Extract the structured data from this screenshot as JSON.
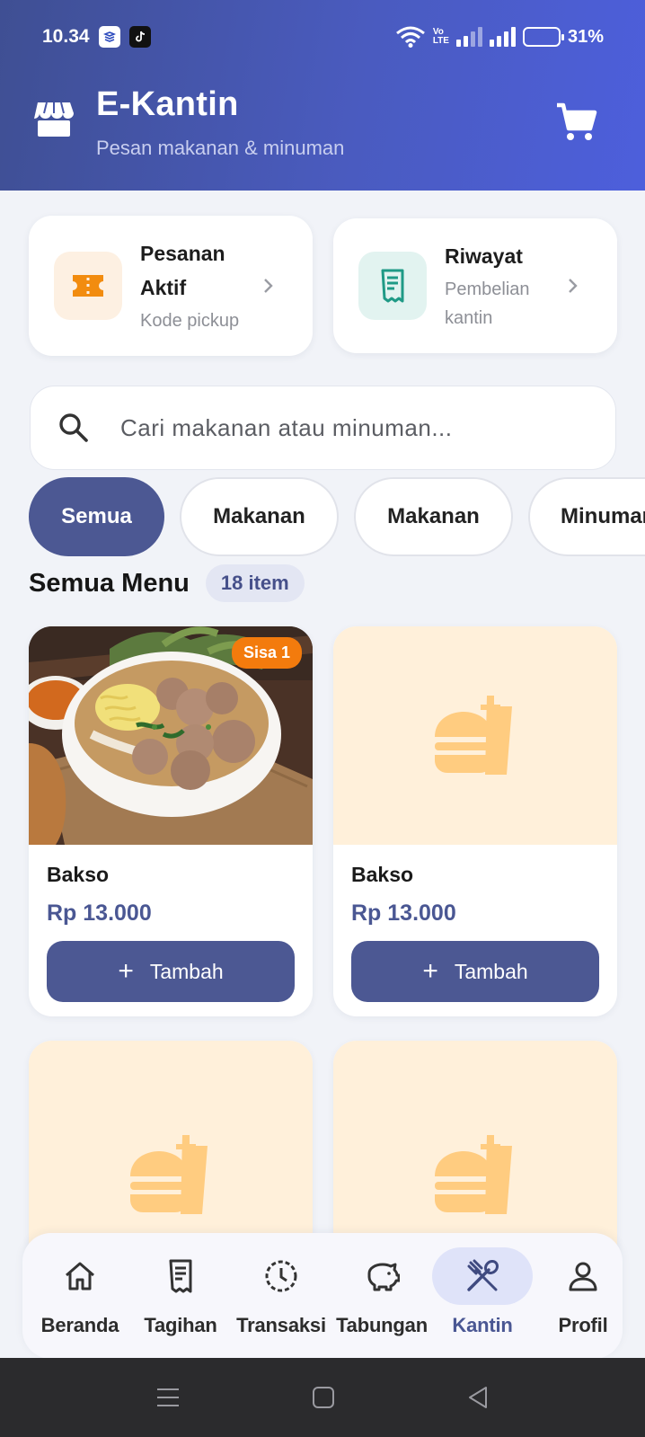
{
  "status_bar": {
    "time": "10.34",
    "network_label": "Vo\nLTE",
    "battery_pct": "31%",
    "battery_level": 0.31
  },
  "header": {
    "title": "E-Kantin",
    "subtitle": "Pesan makanan & minuman"
  },
  "quick_cards": [
    {
      "title": "Pesanan Aktif",
      "subtitle": "Kode pickup",
      "icon": "ticket-icon",
      "color": "#f28c0f"
    },
    {
      "title": "Riwayat",
      "subtitle": "Pembelian kantin",
      "icon": "receipt-icon",
      "color": "#1f9a86"
    }
  ],
  "search": {
    "placeholder": "Cari makanan atau minuman..."
  },
  "categories": [
    {
      "label": "Semua",
      "active": true
    },
    {
      "label": "Makanan",
      "active": false
    },
    {
      "label": "Makanan",
      "active": false
    },
    {
      "label": "Minuman",
      "active": false
    }
  ],
  "section": {
    "title": "Semua Menu",
    "count": "18 item"
  },
  "products": [
    {
      "name": "Bakso",
      "price": "Rp 13.000",
      "button": "Tambah",
      "badge": "Sisa 1",
      "has_photo": true
    },
    {
      "name": "Bakso",
      "price": "Rp 13.000",
      "button": "Tambah",
      "badge": "",
      "has_photo": false
    },
    {
      "name": "",
      "price": "",
      "button": "",
      "badge": "",
      "has_photo": false
    },
    {
      "name": "",
      "price": "",
      "button": "",
      "badge": "",
      "has_photo": false
    }
  ],
  "nav": [
    {
      "label": "Beranda",
      "icon": "home-icon",
      "active": false
    },
    {
      "label": "Tagihan",
      "icon": "bill-icon",
      "active": false
    },
    {
      "label": "Transaksi",
      "icon": "clock-icon",
      "active": false
    },
    {
      "label": "Tabungan",
      "icon": "piggy-bank-icon",
      "active": false
    },
    {
      "label": "Kantin",
      "icon": "utensils-icon",
      "active": true
    },
    {
      "label": "Profil",
      "icon": "user-icon",
      "active": false
    }
  ],
  "colors": {
    "primary": "#4c5893",
    "accent_orange": "#f37b0d",
    "placeholder_bg": "#fff0da",
    "placeholder_icon": "#ffcc80"
  }
}
